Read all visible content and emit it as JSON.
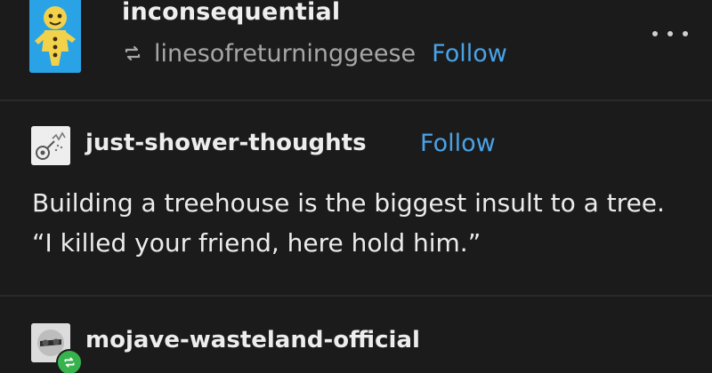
{
  "post": {
    "blog_name": "inconsequential",
    "reblogged_from": "linesofreturninggeese",
    "follow_label": "Follow",
    "avatar_icon": "gingerbread-man-icon",
    "reblog_icon": "reblog-icon",
    "menu_icon": "more-options-icon",
    "accent_color": "#4aa3e6"
  },
  "entries": [
    {
      "name": "just-shower-thoughts",
      "follow_label": "Follow",
      "avatar_icon": "shower-avatar-icon",
      "text": "Building a treehouse is the biggest insult to a tree. “I killed your friend, here hold him.”"
    },
    {
      "name": "mojave-wasteland-official",
      "avatar_icon": "wasteland-avatar-icon",
      "badge_icon": "reblog-badge-icon"
    }
  ]
}
